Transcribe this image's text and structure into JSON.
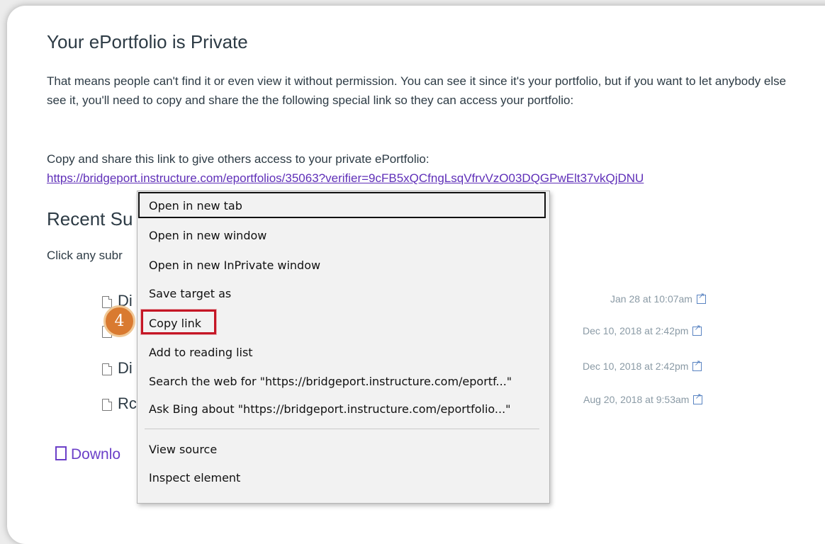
{
  "page": {
    "title": "Your ePortfolio is Private",
    "description": "That means people can't find it or even view it without permission. You can see it since it's your portfolio, but if you want to let anybody else see it, you'll need to copy and share the the following special link so they can access your portfolio:",
    "share_prompt": "Copy and share this link to give others access to your private ePortfolio:",
    "share_link": "https://bridgeport.instructure.com/eportfolios/35063?verifier=9cFB5xQCfngLsqVfrvVzO03DQGPwElt37vkQjDNU"
  },
  "recent": {
    "heading": "Recent Su",
    "hint": "Click any subr",
    "submissions": [
      {
        "title": "Di",
        "date": "Jan 28 at 10:07am"
      },
      {
        "title": "",
        "date": "Dec 10, 2018 at 2:42pm"
      },
      {
        "title": "Di",
        "date": "Dec 10, 2018 at 2:42pm"
      },
      {
        "title": "Rc",
        "date": "Aug 20, 2018 at 9:53am"
      }
    ],
    "download_label": "Downlo"
  },
  "context_menu": {
    "items": [
      "Open in new tab",
      "Open in new window",
      "Open in new InPrivate window",
      "Save target as",
      "Copy link",
      "Add to reading list",
      "Search the web for \"https://bridgeport.instructure.com/eportf...\"",
      "Ask Bing about \"https://bridgeport.instructure.com/eportfolio...\"",
      "View source",
      "Inspect element"
    ]
  },
  "step_badge": "4",
  "colors": {
    "link": "#5f2fb8",
    "highlight": "#c51625",
    "badge": "#d97a30"
  }
}
